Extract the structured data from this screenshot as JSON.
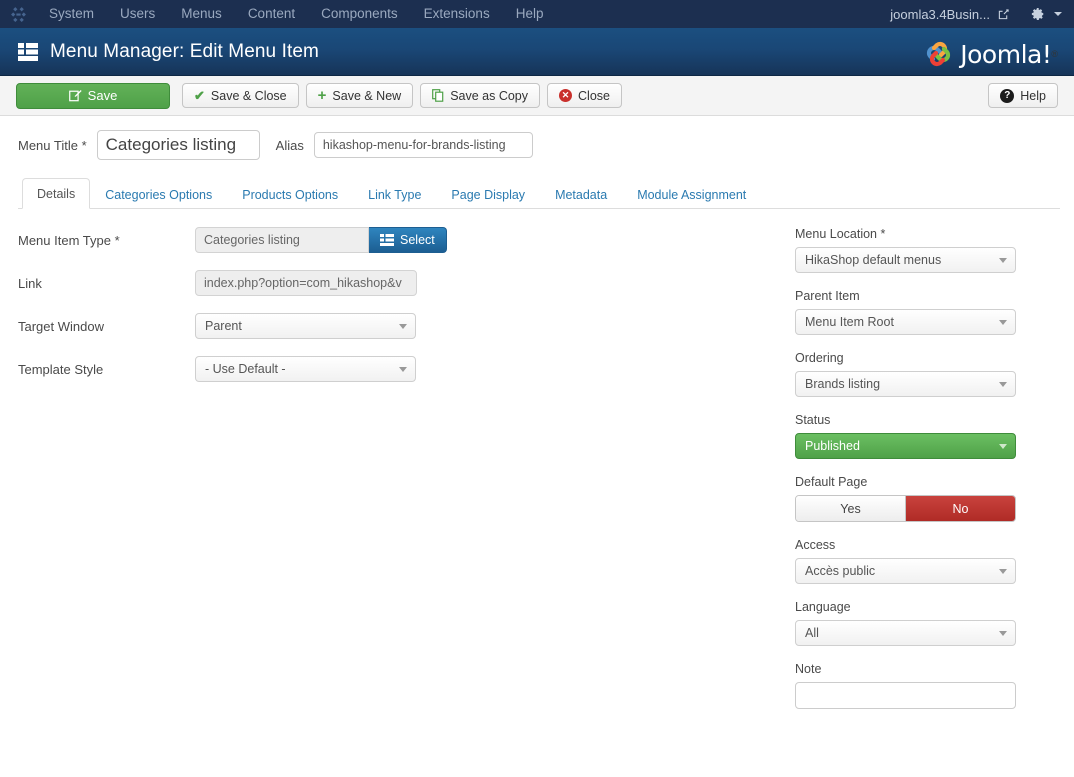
{
  "navbar": {
    "brand_icon": "joomla-brand-icon",
    "items": [
      {
        "label": "System"
      },
      {
        "label": "Users"
      },
      {
        "label": "Menus"
      },
      {
        "label": "Content"
      },
      {
        "label": "Components"
      },
      {
        "label": "Extensions"
      },
      {
        "label": "Help"
      }
    ],
    "site_name": "joomla3.4Busin...",
    "preview_icon": "external-link-icon",
    "gear_icon": "gear-icon",
    "caret_icon": "chevron-down-icon",
    "background": "#1c2f50"
  },
  "header": {
    "icon": "menu-list-icon",
    "title": "Menu Manager: Edit Menu Item",
    "logo_text": "Joomla!",
    "logo_reg": "®",
    "background_top": "#1b4f80",
    "background_bottom": "#163458"
  },
  "toolbar": {
    "save_label": "Save",
    "save_icon": "edit-pencil-icon",
    "save_close_label": "Save & Close",
    "save_close_icon": "check-icon",
    "save_new_label": "Save & New",
    "save_new_icon": "plus-icon",
    "save_copy_label": "Save as Copy",
    "save_copy_icon": "copy-icon",
    "close_label": "Close",
    "close_icon": "close-circle-icon",
    "help_label": "Help",
    "help_icon": "help-circle-icon",
    "save_color": "#4fa148"
  },
  "title_row": {
    "menu_title_label": "Menu Title *",
    "menu_title_value": "Categories listing",
    "alias_label": "Alias",
    "alias_value": "hikashop-menu-for-brands-listing"
  },
  "tabs": [
    {
      "label": "Details",
      "active": true
    },
    {
      "label": "Categories Options",
      "active": false
    },
    {
      "label": "Products Options",
      "active": false
    },
    {
      "label": "Link Type",
      "active": false
    },
    {
      "label": "Page Display",
      "active": false
    },
    {
      "label": "Metadata",
      "active": false
    },
    {
      "label": "Module Assignment",
      "active": false
    }
  ],
  "details": {
    "menu_item_type_label": "Menu Item Type *",
    "menu_item_type_value": "Categories listing",
    "select_button_label": "Select",
    "select_button_icon": "grid-list-icon",
    "link_label": "Link",
    "link_value": "index.php?option=com_hikashop&v",
    "target_window_label": "Target Window",
    "target_window_value": "Parent",
    "template_style_label": "Template Style",
    "template_style_value": "- Use Default -"
  },
  "sidebar": {
    "menu_location_label": "Menu Location *",
    "menu_location_value": "HikaShop default menus",
    "parent_item_label": "Parent Item",
    "parent_item_value": "Menu Item Root",
    "ordering_label": "Ordering",
    "ordering_value": "Brands listing",
    "status_label": "Status",
    "status_value": "Published",
    "status_color": "#4fa148",
    "default_page_label": "Default Page",
    "default_page_yes": "Yes",
    "default_page_no": "No",
    "default_page_selected": "No",
    "default_page_no_color": "#b02b26",
    "access_label": "Access",
    "access_value": "Accès public",
    "language_label": "Language",
    "language_value": "All",
    "note_label": "Note",
    "note_value": "",
    "note_placeholder": ""
  }
}
